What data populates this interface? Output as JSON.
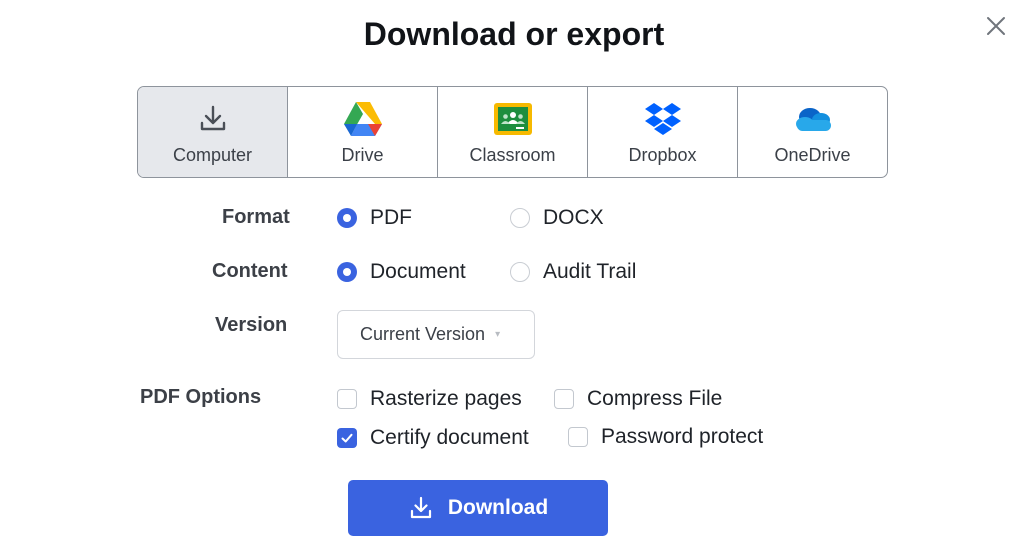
{
  "dialog": {
    "title": "Download or export",
    "close_icon": "close-icon"
  },
  "destinations": [
    {
      "label": "Computer",
      "icon": "download-icon",
      "active": true
    },
    {
      "label": "Drive",
      "icon": "google-drive-icon",
      "active": false
    },
    {
      "label": "Classroom",
      "icon": "google-classroom-icon",
      "active": false
    },
    {
      "label": "Dropbox",
      "icon": "dropbox-icon",
      "active": false
    },
    {
      "label": "OneDrive",
      "icon": "onedrive-icon",
      "active": false
    }
  ],
  "format": {
    "label": "Format",
    "options": [
      {
        "label": "PDF",
        "selected": true
      },
      {
        "label": "DOCX",
        "selected": false
      }
    ]
  },
  "content": {
    "label": "Content",
    "options": [
      {
        "label": "Document",
        "selected": true
      },
      {
        "label": "Audit Trail",
        "selected": false
      }
    ]
  },
  "version": {
    "label": "Version",
    "selected": "Current Version"
  },
  "pdf_options": {
    "label": "PDF Options",
    "options": [
      {
        "label": "Rasterize pages",
        "checked": false
      },
      {
        "label": "Compress File",
        "checked": false
      },
      {
        "label": "Certify document",
        "checked": true
      },
      {
        "label": "Password protect",
        "checked": false
      }
    ]
  },
  "download_button": {
    "label": "Download",
    "icon": "download-icon"
  },
  "colors": {
    "accent": "#3a63e0",
    "active_tab": "#e6e8ec",
    "border": "#8e949c"
  }
}
